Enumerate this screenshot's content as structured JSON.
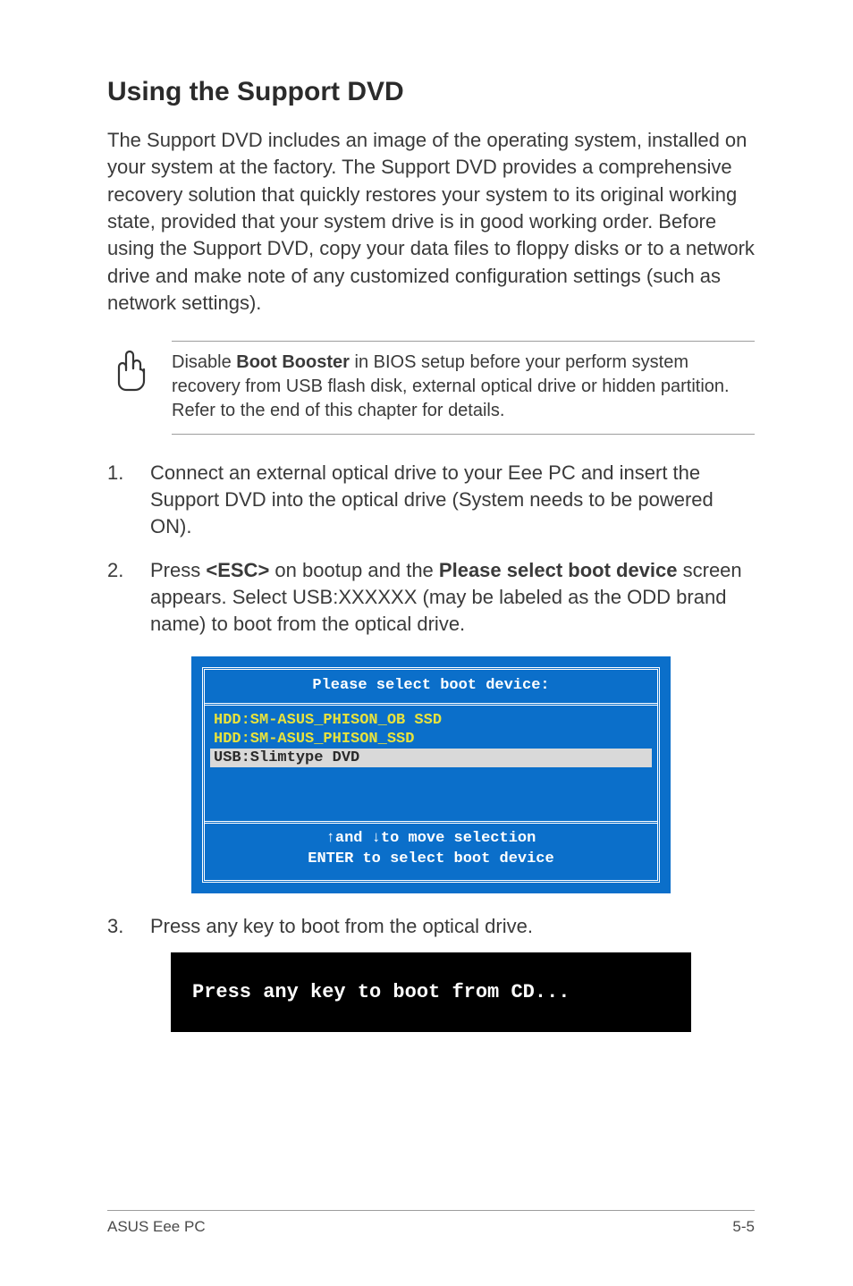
{
  "title": "Using the Support DVD",
  "intro": "The Support DVD includes an image of the operating system, installed on your system at the factory. The Support DVD provides a comprehensive recovery solution that quickly restores your system to its original working state, provided that your system drive is in good working order. Before using the Support DVD, copy your data files to floppy disks or to a network drive and make note of any customized configuration settings (such as network settings).",
  "note": {
    "pre": "Disable ",
    "bold": "Boot Booster",
    "post": " in BIOS setup before your perform system recovery from USB flash disk, external optical drive or hidden partition. Refer to the end of this chapter for details."
  },
  "steps": {
    "s1": "Connect an external optical drive to your Eee PC and insert the Support DVD into the optical drive (System needs to be powered ON).",
    "s2_a": "Press ",
    "s2_esc": "<ESC>",
    "s2_b": " on bootup and the ",
    "s2_bold": "Please select boot device",
    "s2_c": " screen appears. Select USB:XXXXXX (may be labeled as the ODD brand name) to boot from the optical drive.",
    "s3_num": "3.",
    "s3": "Press any key to boot from the optical drive."
  },
  "bios": {
    "header": "Please select boot device:",
    "line1": "HDD:SM-ASUS_PHISON_OB SSD",
    "line2": "HDD:SM-ASUS_PHISON_SSD",
    "line3": "USB:Slimtype DVD",
    "footer1": "↑and ↓to move selection",
    "footer2": "ENTER to select boot device"
  },
  "blackbox": "Press any key to boot from CD...",
  "footer": {
    "left": "ASUS Eee PC",
    "right": "5-5"
  }
}
